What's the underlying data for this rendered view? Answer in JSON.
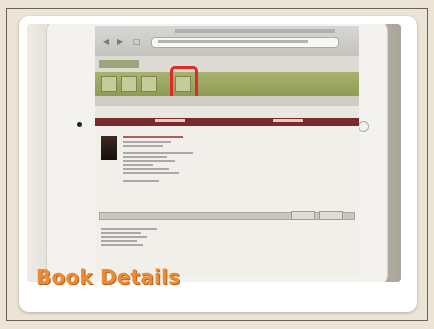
{
  "slide": {
    "caption": "Book Details"
  },
  "photo": {
    "subject": "tablet-screenshot",
    "highlight_color": "#e02a2a"
  },
  "colors": {
    "background": "#ece5d6",
    "caption": "#ee8b32",
    "nav_band": "#9aa55f",
    "tab_bar": "#7a2a2a"
  }
}
